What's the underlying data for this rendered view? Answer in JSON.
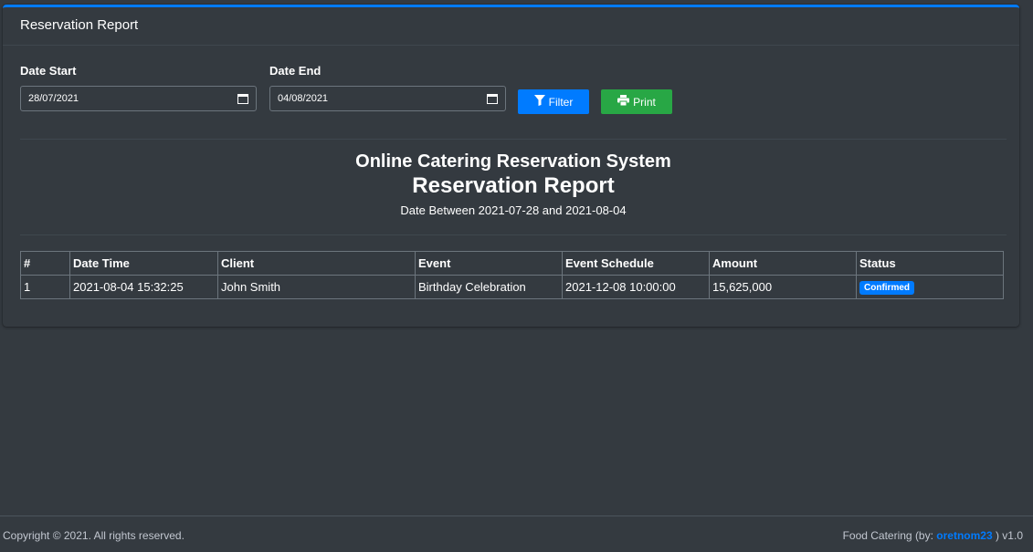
{
  "card": {
    "title": "Reservation Report"
  },
  "filters": {
    "date_start_label": "Date Start",
    "date_start_value": "28/07/2021",
    "date_end_label": "Date End",
    "date_end_value": "04/08/2021",
    "filter_label": "Filter",
    "print_label": "Print",
    "icons": {
      "filter": "filter-icon",
      "print": "printer-icon",
      "calendar": "calendar-icon"
    }
  },
  "report": {
    "system_name": "Online Catering Reservation System",
    "title": "Reservation Report",
    "date_range": "Date Between 2021-07-28 and 2021-08-04"
  },
  "table": {
    "headers": [
      "#",
      "Date Time",
      "Client",
      "Event",
      "Event Schedule",
      "Amount",
      "Status"
    ],
    "rows": [
      {
        "num": "1",
        "date_time": "2021-08-04 15:32:25",
        "client": "John Smith",
        "event": "Birthday Celebration",
        "schedule": "2021-12-08 10:00:00",
        "amount": "15,625,000",
        "status": "Confirmed"
      }
    ]
  },
  "footer": {
    "copyright": "Copyright © 2021. All rights reserved.",
    "credit_prefix": "Food Catering (by: ",
    "credit_author": "oretnom23",
    "credit_suffix": " ) v1.0"
  },
  "colors": {
    "accent": "#007bff",
    "success": "#28a745",
    "background": "#343a40"
  }
}
